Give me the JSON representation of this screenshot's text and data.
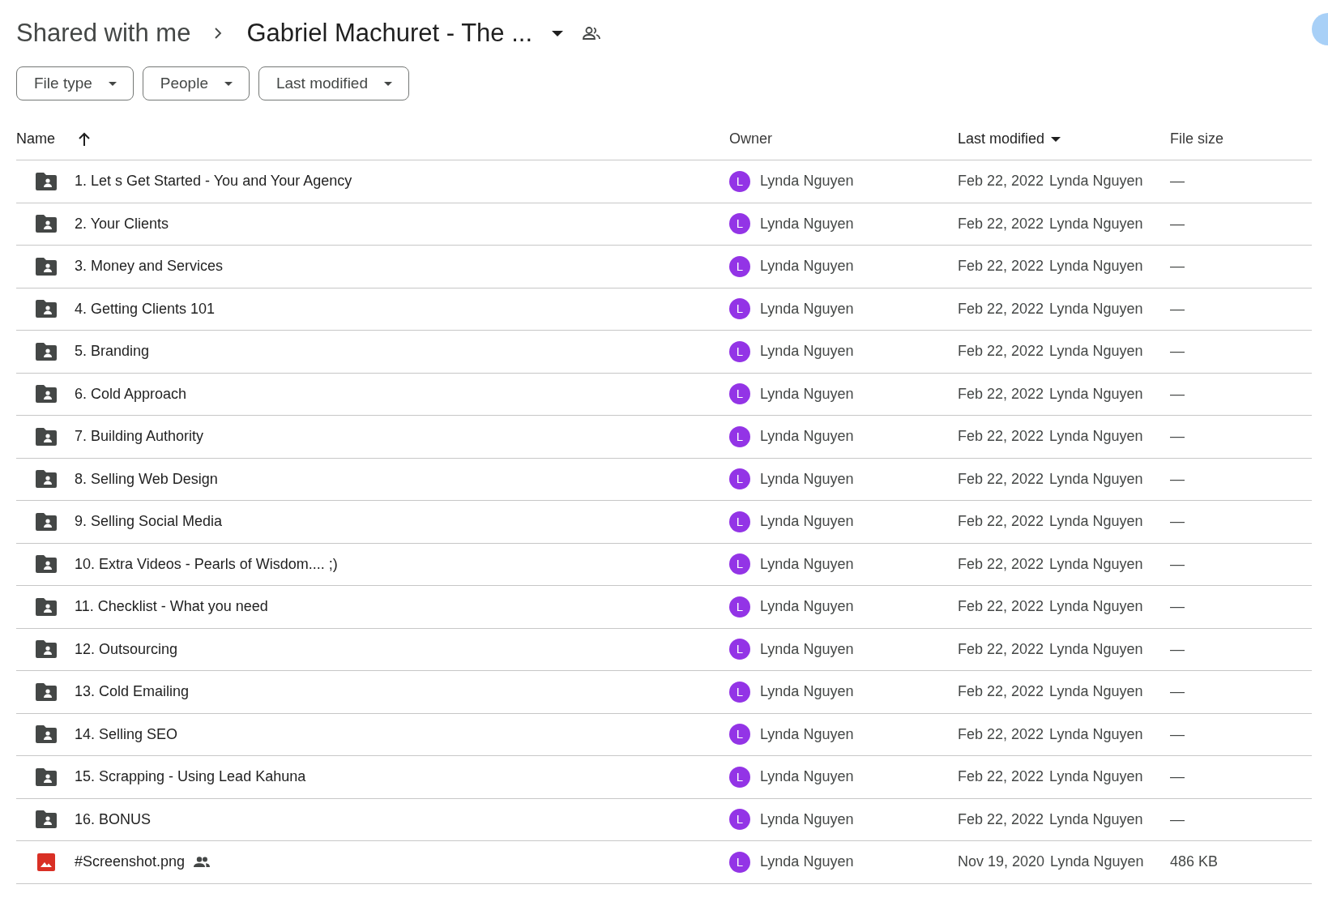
{
  "breadcrumb": {
    "parent": "Shared with me",
    "current": "Gabriel Machuret - The ..."
  },
  "filters": [
    "File type",
    "People",
    "Last modified"
  ],
  "table": {
    "columns": [
      {
        "label": "Name",
        "sorted": true,
        "kind": "arrow",
        "descending": false
      },
      {
        "label": "Owner",
        "sorted": false
      },
      {
        "label": "Last modified",
        "sorted": true,
        "kind": "caret",
        "descending": true
      },
      {
        "label": "File size",
        "sorted": false
      }
    ],
    "rows": [
      {
        "kind": "folder",
        "name": "1. Let s Get Started - You and Your Agency",
        "shared": false,
        "owner_initial": "L",
        "owner": "Lynda Nguyen",
        "date": "Feb 22, 2022",
        "modified_by": "Lynda Nguyen",
        "size": "—"
      },
      {
        "kind": "folder",
        "name": "2. Your Clients",
        "shared": false,
        "owner_initial": "L",
        "owner": "Lynda Nguyen",
        "date": "Feb 22, 2022",
        "modified_by": "Lynda Nguyen",
        "size": "—"
      },
      {
        "kind": "folder",
        "name": "3. Money and Services",
        "shared": false,
        "owner_initial": "L",
        "owner": "Lynda Nguyen",
        "date": "Feb 22, 2022",
        "modified_by": "Lynda Nguyen",
        "size": "—"
      },
      {
        "kind": "folder",
        "name": "4. Getting Clients 101",
        "shared": false,
        "owner_initial": "L",
        "owner": "Lynda Nguyen",
        "date": "Feb 22, 2022",
        "modified_by": "Lynda Nguyen",
        "size": "—"
      },
      {
        "kind": "folder",
        "name": "5. Branding",
        "shared": false,
        "owner_initial": "L",
        "owner": "Lynda Nguyen",
        "date": "Feb 22, 2022",
        "modified_by": "Lynda Nguyen",
        "size": "—"
      },
      {
        "kind": "folder",
        "name": "6. Cold Approach",
        "shared": false,
        "owner_initial": "L",
        "owner": "Lynda Nguyen",
        "date": "Feb 22, 2022",
        "modified_by": "Lynda Nguyen",
        "size": "—"
      },
      {
        "kind": "folder",
        "name": "7. Building Authority",
        "shared": false,
        "owner_initial": "L",
        "owner": "Lynda Nguyen",
        "date": "Feb 22, 2022",
        "modified_by": "Lynda Nguyen",
        "size": "—"
      },
      {
        "kind": "folder",
        "name": "8. Selling Web Design",
        "shared": false,
        "owner_initial": "L",
        "owner": "Lynda Nguyen",
        "date": "Feb 22, 2022",
        "modified_by": "Lynda Nguyen",
        "size": "—"
      },
      {
        "kind": "folder",
        "name": "9. Selling Social Media",
        "shared": false,
        "owner_initial": "L",
        "owner": "Lynda Nguyen",
        "date": "Feb 22, 2022",
        "modified_by": "Lynda Nguyen",
        "size": "—"
      },
      {
        "kind": "folder",
        "name": "10. Extra Videos - Pearls of Wisdom.... ;)",
        "shared": false,
        "owner_initial": "L",
        "owner": "Lynda Nguyen",
        "date": "Feb 22, 2022",
        "modified_by": "Lynda Nguyen",
        "size": "—"
      },
      {
        "kind": "folder",
        "name": "11. Checklist - What you need",
        "shared": false,
        "owner_initial": "L",
        "owner": "Lynda Nguyen",
        "date": "Feb 22, 2022",
        "modified_by": "Lynda Nguyen",
        "size": "—"
      },
      {
        "kind": "folder",
        "name": "12. Outsourcing",
        "shared": false,
        "owner_initial": "L",
        "owner": "Lynda Nguyen",
        "date": "Feb 22, 2022",
        "modified_by": "Lynda Nguyen",
        "size": "—"
      },
      {
        "kind": "folder",
        "name": "13. Cold Emailing",
        "shared": false,
        "owner_initial": "L",
        "owner": "Lynda Nguyen",
        "date": "Feb 22, 2022",
        "modified_by": "Lynda Nguyen",
        "size": "—"
      },
      {
        "kind": "folder",
        "name": "14. Selling SEO",
        "shared": false,
        "owner_initial": "L",
        "owner": "Lynda Nguyen",
        "date": "Feb 22, 2022",
        "modified_by": "Lynda Nguyen",
        "size": "—"
      },
      {
        "kind": "folder",
        "name": "15. Scrapping - Using Lead Kahuna",
        "shared": false,
        "owner_initial": "L",
        "owner": "Lynda Nguyen",
        "date": "Feb 22, 2022",
        "modified_by": "Lynda Nguyen",
        "size": "—"
      },
      {
        "kind": "folder",
        "name": "16. BONUS",
        "shared": false,
        "owner_initial": "L",
        "owner": "Lynda Nguyen",
        "date": "Feb 22, 2022",
        "modified_by": "Lynda Nguyen",
        "size": "—"
      },
      {
        "kind": "image",
        "name": "#Screenshot.png",
        "shared": true,
        "owner_initial": "L",
        "owner": "Lynda Nguyen",
        "date": "Nov 19, 2020",
        "modified_by": "Lynda Nguyen",
        "size": "486 KB"
      }
    ]
  }
}
